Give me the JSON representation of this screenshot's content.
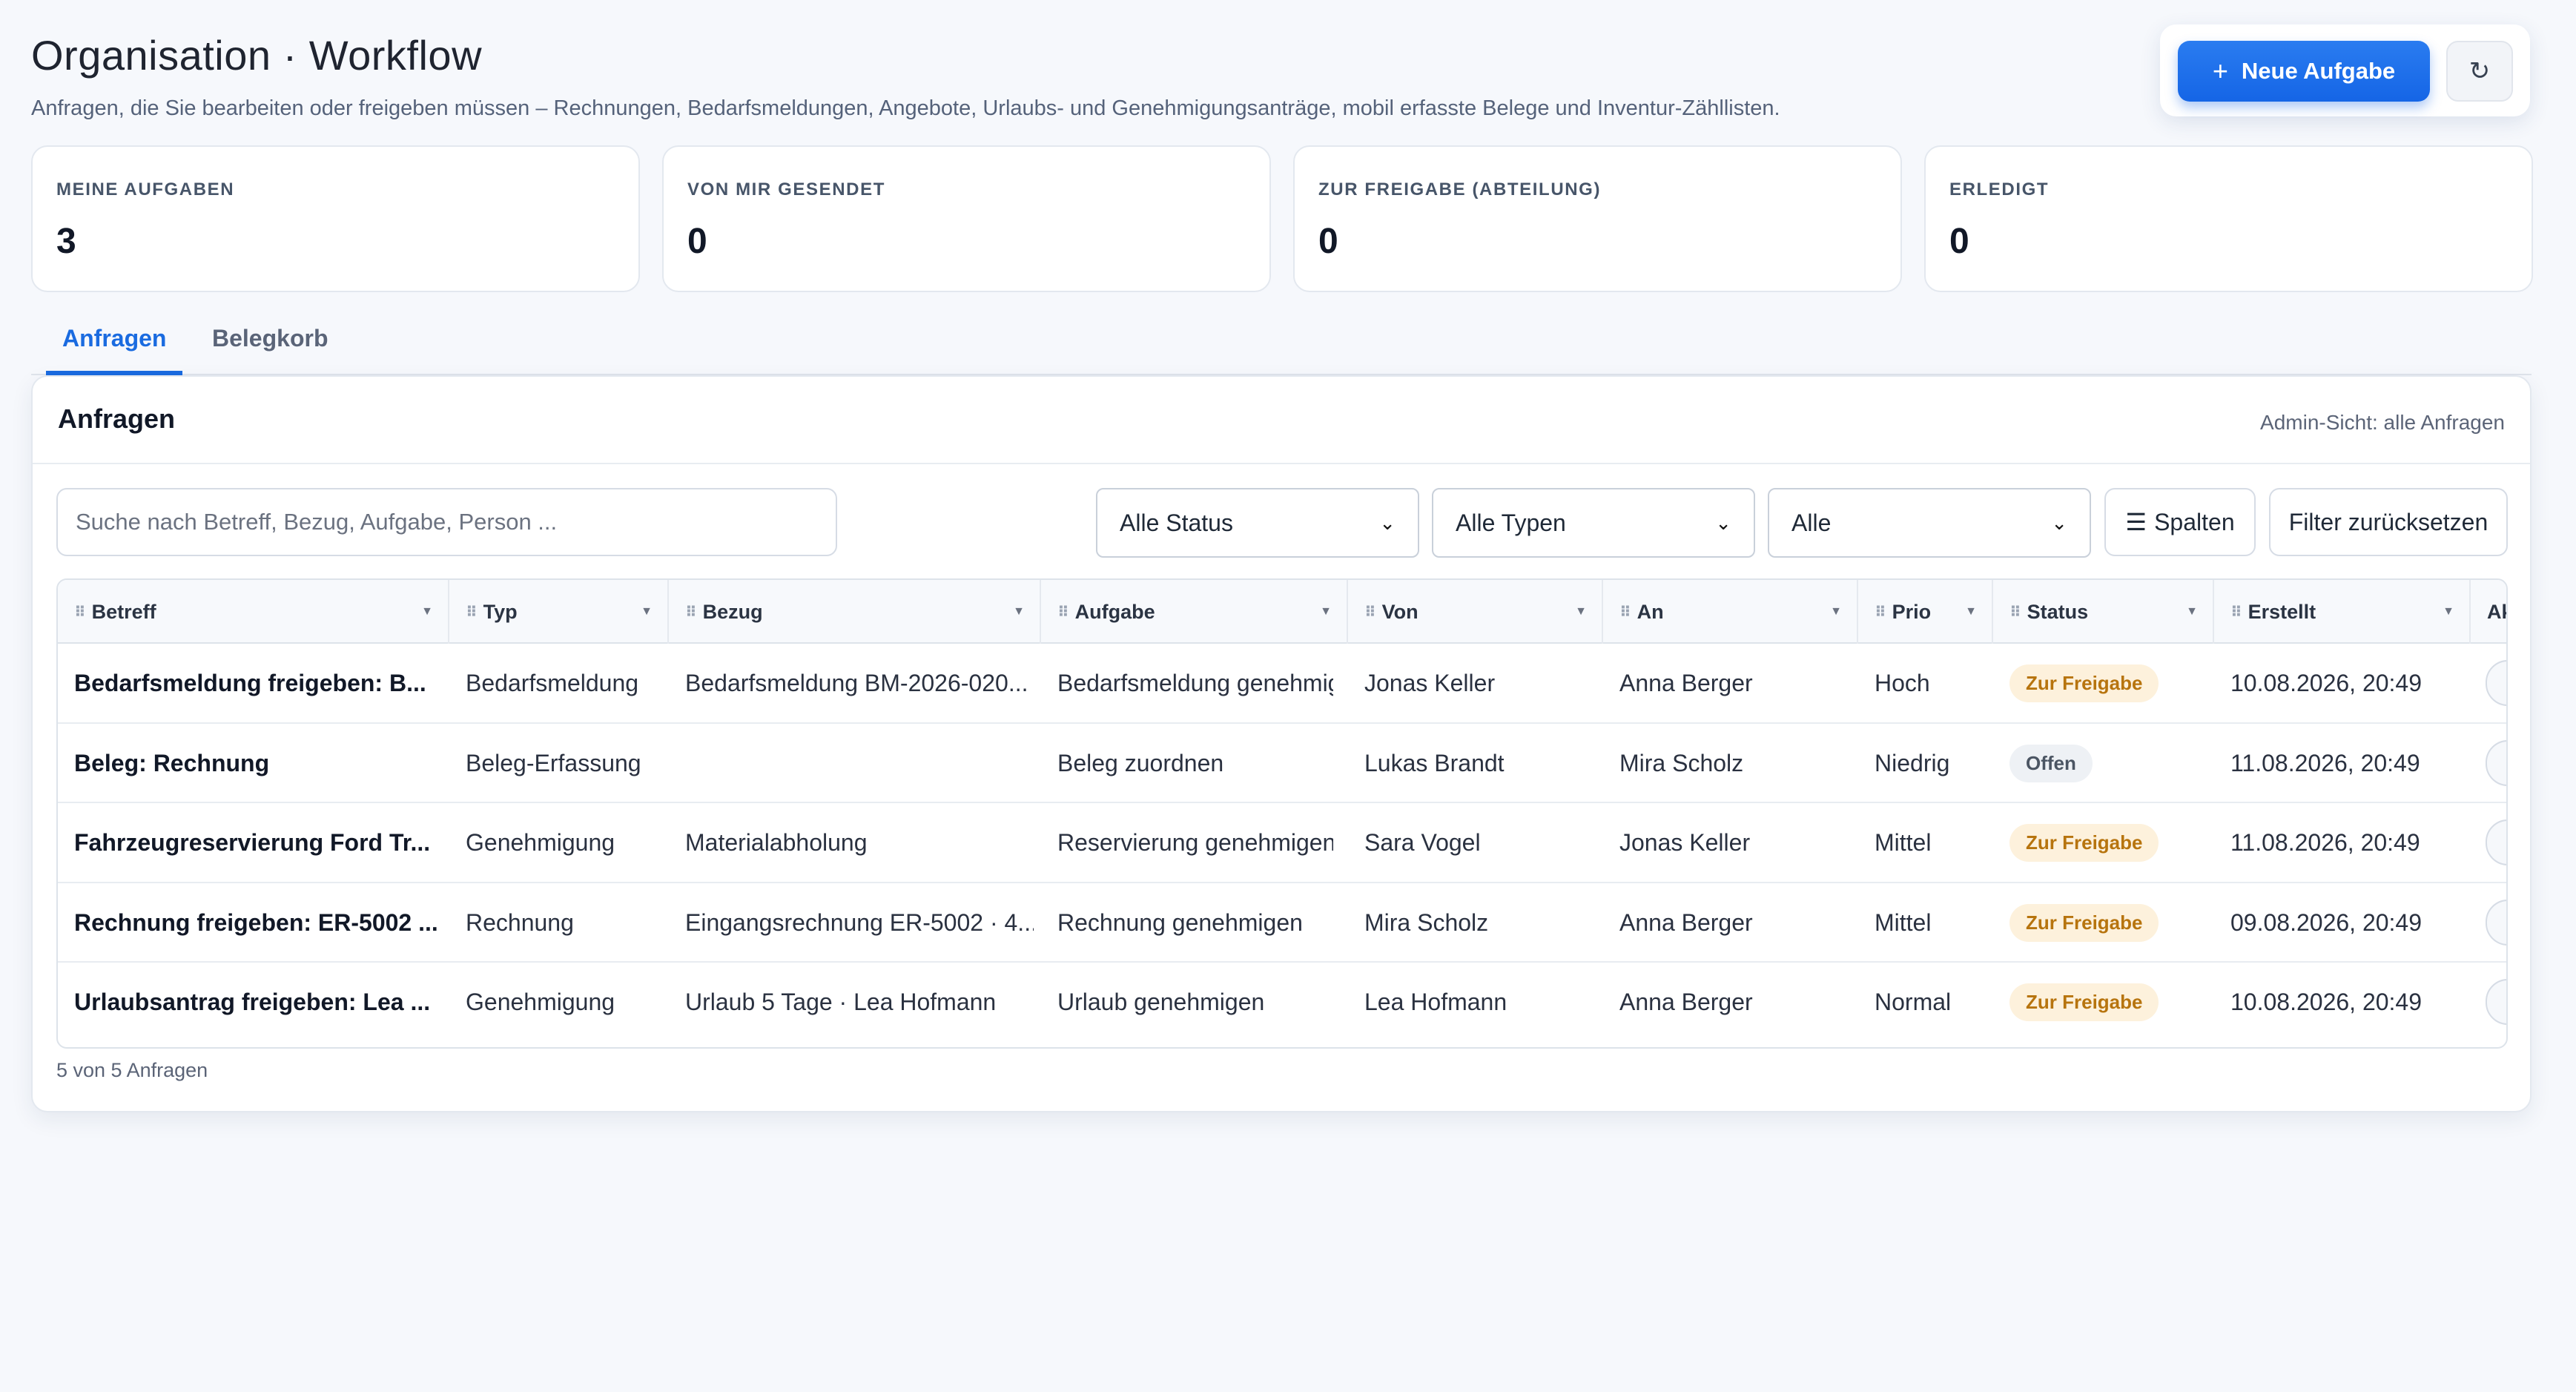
{
  "header": {
    "title": "Organisation · Workflow",
    "subtitle": "Anfragen, die Sie bearbeiten oder freigeben müssen – Rechnungen, Bedarfsmeldungen, Angebote, Urlaubs- und Genehmigungsanträge, mobil erfasste Belege und Inventur-Zähllisten."
  },
  "actions": {
    "new_task_label": "Neue Aufgabe",
    "new_task_icon": "+",
    "refresh_icon": "↻"
  },
  "stats": [
    {
      "label": "MEINE AUFGABEN",
      "value": "3"
    },
    {
      "label": "VON MIR GESENDET",
      "value": "0"
    },
    {
      "label": "ZUR FREIGABE (ABTEILUNG)",
      "value": "0"
    },
    {
      "label": "ERLEDIGT",
      "value": "0"
    }
  ],
  "tabs": [
    {
      "label": "Anfragen",
      "active": true
    },
    {
      "label": "Belegkorb",
      "active": false
    }
  ],
  "panel": {
    "title": "Anfragen",
    "note": "Admin-Sicht: alle Anfragen"
  },
  "filters": {
    "search_placeholder": "Suche nach Betreff, Bezug, Aufgabe, Person ...",
    "status_value": "Alle Status",
    "type_value": "Alle Typen",
    "scope_value": "Alle",
    "columns_label": "Spalten",
    "columns_icon": "☰",
    "reset_label": "Filter zurücksetzen"
  },
  "table": {
    "columns": [
      "Betreff",
      "Typ",
      "Bezug",
      "Aufgabe",
      "Von",
      "An",
      "Prio",
      "Status",
      "Erstellt",
      "Ak"
    ],
    "rows": [
      [
        "Bedarfsmeldung freigeben: B...",
        "Bedarfsmeldung",
        "Bedarfsmeldung BM-2026-020...",
        "Bedarfsmeldung genehmigen",
        "Jonas Keller",
        "Anna Berger",
        "Hoch",
        "Zur Freigabe",
        "10.08.2026, 20:49"
      ],
      [
        "Beleg: Rechnung",
        "Beleg-Erfassung",
        "",
        "Beleg zuordnen",
        "Lukas Brandt",
        "Mira Scholz",
        "Niedrig",
        "Offen",
        "11.08.2026, 20:49"
      ],
      [
        "Fahrzeugreservierung Ford Tr...",
        "Genehmigung",
        "Materialabholung",
        "Reservierung genehmigen",
        "Sara Vogel",
        "Jonas Keller",
        "Mittel",
        "Zur Freigabe",
        "11.08.2026, 20:49"
      ],
      [
        "Rechnung freigeben: ER-5002 ...",
        "Rechnung",
        "Eingangsrechnung ER-5002 · 4...",
        "Rechnung genehmigen",
        "Mira Scholz",
        "Anna Berger",
        "Mittel",
        "Zur Freigabe",
        "09.08.2026, 20:49"
      ],
      [
        "Urlaubsantrag freigeben: Lea ...",
        "Genehmigung",
        "Urlaub 5 Tage · Lea Hofmann",
        "Urlaub genehmigen",
        "Lea Hofmann",
        "Anna Berger",
        "Normal",
        "Zur Freigabe",
        "10.08.2026, 20:49"
      ]
    ]
  },
  "footer": {
    "count_text": "5 von 5 Anfragen"
  },
  "colors": {
    "accent": "#1a6be0",
    "status_pending_bg": "#fdf1dc",
    "status_pending_text": "#b7740e",
    "status_open_bg": "#eef1f5"
  }
}
